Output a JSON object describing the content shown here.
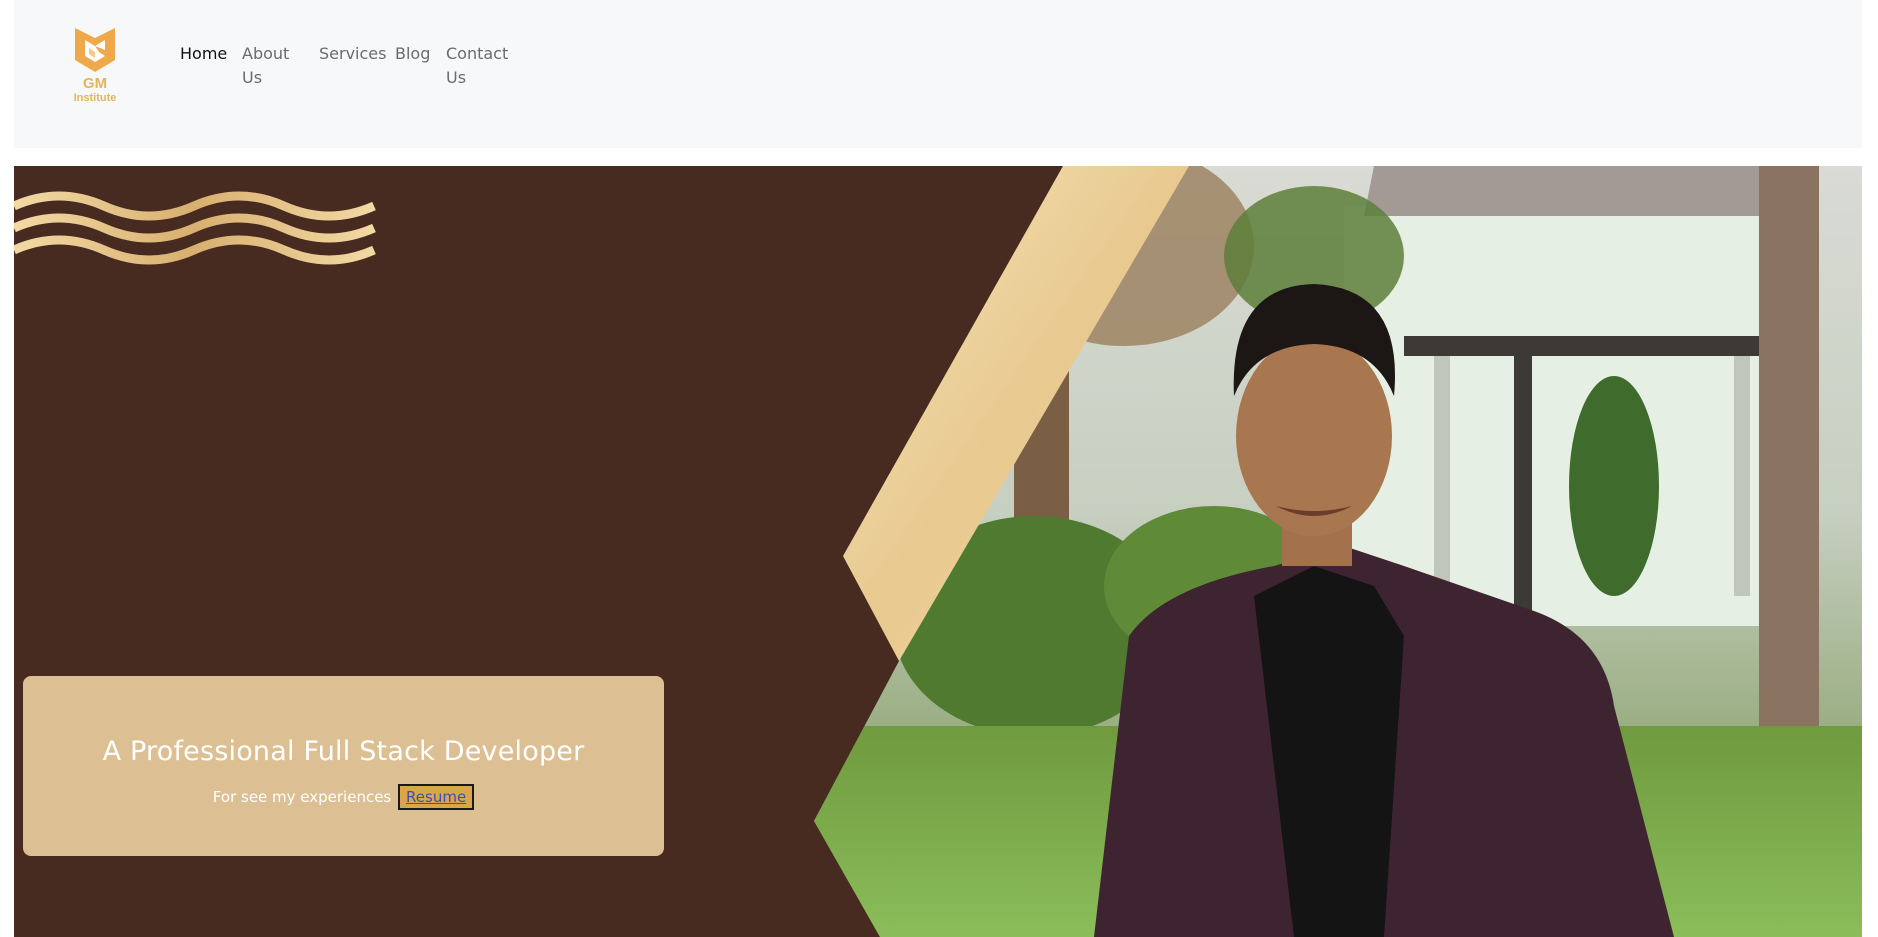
{
  "brand": {
    "name": "GM",
    "subtitle": "Institute",
    "logo_icon": "gm-hexagon-logo-icon",
    "color": "#e2b55e"
  },
  "nav": {
    "items": [
      {
        "label": "Home",
        "active": true
      },
      {
        "label": "About Us",
        "active": false
      },
      {
        "label": "Services",
        "active": false
      },
      {
        "label": "Blog",
        "active": false
      },
      {
        "label": "Contact Us",
        "active": false
      }
    ]
  },
  "hero": {
    "background_color": "#472a20",
    "accent_gold": "#f0d9a8",
    "photo_description_icon": "portrait-photo",
    "card": {
      "title": "A Professional Full Stack Developer",
      "text": "For see my experiences",
      "button_label": "Resume",
      "background_color": "#dcc093",
      "button_color": "#d9a74a"
    }
  }
}
